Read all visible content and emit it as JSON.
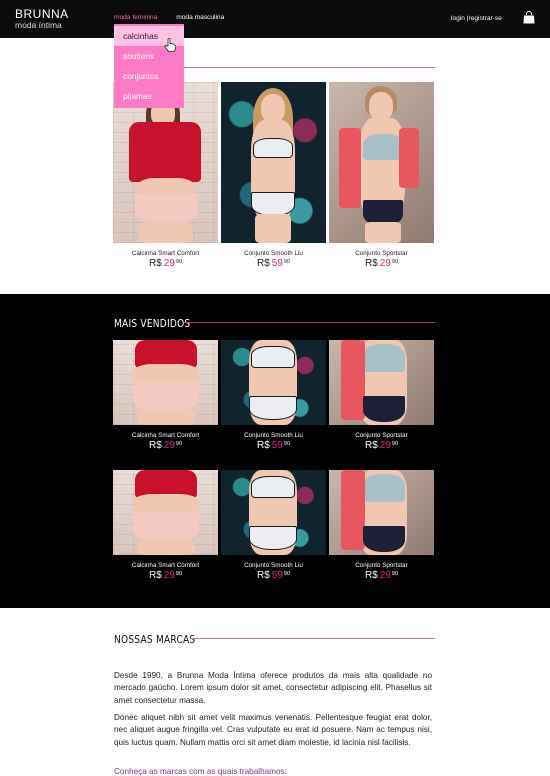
{
  "brand": {
    "name": "BRUNNA",
    "subtitle": "moda íntima"
  },
  "nav": {
    "items": [
      "moda feminina",
      "moda masculina"
    ]
  },
  "account": {
    "login": "login",
    "separator": "|",
    "register": "registrar-se"
  },
  "dropdown": {
    "items": [
      "calcinhas",
      "soutiens",
      "conjuntos",
      "pijamas"
    ],
    "hovered_index": 0
  },
  "featured": {
    "products": [
      {
        "name": "Calcinha Smart Comfort",
        "currency": "R$",
        "price_int": "29",
        "price_dec": "90"
      },
      {
        "name": "Conjunto Smooth Liu",
        "currency": "R$",
        "price_int": "59",
        "price_dec": "90"
      },
      {
        "name": "Conjunto Sportstar",
        "currency": "R$",
        "price_int": "29",
        "price_dec": "90"
      }
    ]
  },
  "best_sellers": {
    "title": "MAIS VENDIDOS",
    "rows": [
      [
        {
          "name": "Calcinha Smart Comfort",
          "currency": "R$",
          "price_int": "29",
          "price_dec": "90"
        },
        {
          "name": "Conjunto Smooth Liu",
          "currency": "R$",
          "price_int": "59",
          "price_dec": "90"
        },
        {
          "name": "Conjunto Sportstar",
          "currency": "R$",
          "price_int": "29",
          "price_dec": "90"
        }
      ],
      [
        {
          "name": "Calcinha Smart Comfort",
          "currency": "R$",
          "price_int": "29",
          "price_dec": "90"
        },
        {
          "name": "Conjunto Smooth Liu",
          "currency": "R$",
          "price_int": "59",
          "price_dec": "90"
        },
        {
          "name": "Conjunto Sportstar",
          "currency": "R$",
          "price_int": "29",
          "price_dec": "90"
        }
      ]
    ]
  },
  "brands": {
    "title": "NOSSAS MARCAS",
    "paragraph1": "Desde 1990, a Brunna Moda Íntima oferece produtos da mais alta qualidade no mercado gaúcho. Lorem ipsum dolor sit amet, consectetur adipiscing elit. Phasellus sit amet consectetur massa.",
    "paragraph2": "Donec aliquet nibh sit amet velit maximus venenatis. Pellentesque feugiat erat dolor, nec aliquet augue fringilla vel. Cras vulputate eu erat id posuere. Nam ac tempus nisi, quis luctus quam. Nullam mattis orci sit amet diam molestie, id lacinia nisl facilisis.",
    "link": "Conheça as marcas com as quais trabalhamos:"
  },
  "colors": {
    "accent": "#d6287e",
    "dropdown": "#ff7ac6",
    "dropdown_hover": "#ffc2e4",
    "header": "#0b0b0b"
  },
  "icons": {
    "bag": "shopping-bag-icon",
    "cursor": "hand-pointer-icon"
  }
}
